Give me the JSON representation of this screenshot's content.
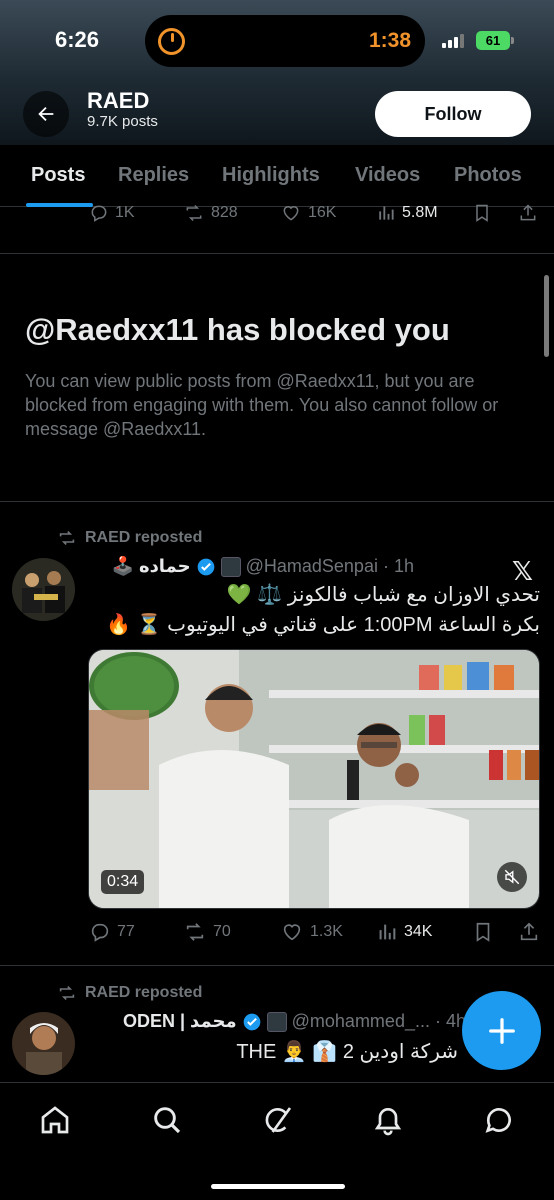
{
  "status_bar": {
    "time": "6:26",
    "timer": "1:38",
    "battery": "61"
  },
  "header": {
    "name": "RAED",
    "posts_count": "9.7K posts",
    "follow_label": "Follow"
  },
  "tabs": [
    {
      "label": "Posts",
      "active": true
    },
    {
      "label": "Replies"
    },
    {
      "label": "Highlights"
    },
    {
      "label": "Videos"
    },
    {
      "label": "Photos"
    }
  ],
  "prev_post_actions": {
    "replies": "1K",
    "reposts": "828",
    "likes": "16K",
    "views": "5.8M"
  },
  "blocked_notice": {
    "title": "@Raedxx11 has blocked you",
    "body": "You can view public posts from @Raedxx11, but you are blocked from engaging with them. You also cannot follow or message @Raedxx11."
  },
  "posts": [
    {
      "repost_label": "RAED reposted",
      "author": "حماده",
      "author_emoji": "🕹️",
      "handle": "@HamadSenpai",
      "time": "· 1h",
      "source_icon": "x-logo",
      "lines": [
        "تحدي الاوزان مع شباب فالكونز ⚖️ 💚",
        "بكرة الساعة 1:00PM على قناتي في اليوتيوب ⏳ 🔥"
      ],
      "video_duration": "0:34",
      "actions": {
        "replies": "77",
        "reposts": "70",
        "likes": "1.3K",
        "views": "34K"
      }
    },
    {
      "repost_label": "RAED reposted",
      "author": "ODEN | محمد",
      "handle": "@mohammed_...",
      "time": "· 4h",
      "lines": [
        "شركة اودين 2 👔 👨‍💼 THE"
      ]
    }
  ],
  "colors": {
    "accent": "#1d9bf0",
    "muted": "#71767b",
    "text": "#e7e9ea",
    "background": "#000000"
  },
  "icons": {
    "back": "arrow-left-icon",
    "compose": "plus-icon",
    "nav": [
      "home-icon",
      "search-icon",
      "grok-icon",
      "bell-icon",
      "messages-icon"
    ]
  }
}
